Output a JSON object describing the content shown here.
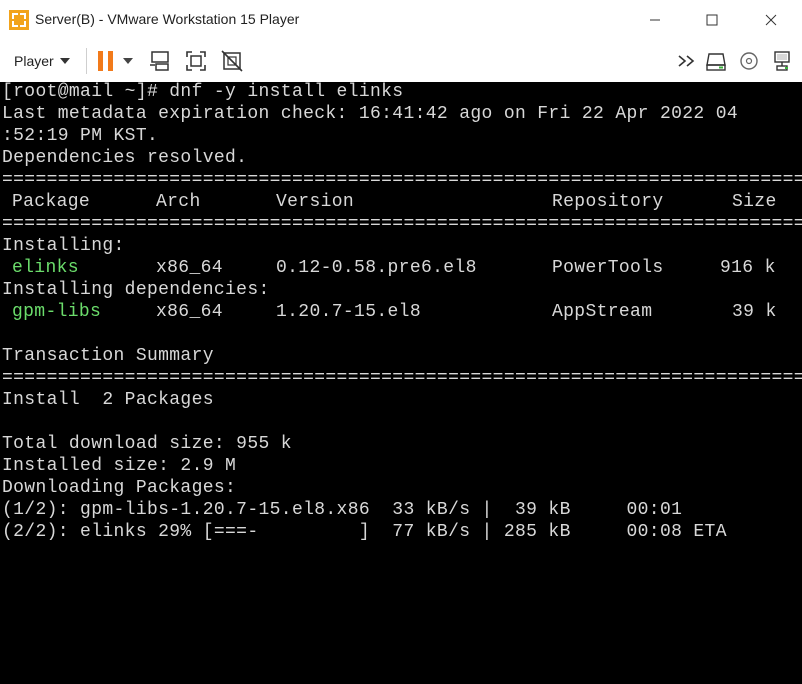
{
  "window": {
    "title": "Server(B) - VMware Workstation 15 Player"
  },
  "toolbar": {
    "player_label": "Player"
  },
  "terminal": {
    "prompt_line": "[root@mail ~]# dnf -y install elinks",
    "metadata_line1": "Last metadata expiration check: 16:41:42 ago on Fri 22 Apr 2022 04",
    "metadata_line2": ":52:19 PM KST.",
    "deps_resolved": "Dependencies resolved.",
    "rule": "==============================================================================================",
    "header": {
      "package": "Package",
      "arch": "Arch",
      "version": "Version",
      "repository": "Repository",
      "size": "Size"
    },
    "installing_label": "Installing:",
    "installing_deps_label": "Installing dependencies:",
    "packages": [
      {
        "name": "elinks",
        "arch": "x86_64",
        "version": "0.12-0.58.pre6.el8",
        "repo": "PowerTools",
        "size": "916 k"
      },
      {
        "name": "gpm-libs",
        "arch": "x86_64",
        "version": "1.20.7-15.el8",
        "repo": "AppStream",
        "size": "39 k"
      }
    ],
    "transaction_summary": "Transaction Summary",
    "install_line": "Install  2 Packages",
    "total_download": "Total download size: 955 k",
    "installed_size": "Installed size: 2.9 M",
    "downloading": "Downloading Packages:",
    "download_lines": [
      "(1/2): gpm-libs-1.20.7-15.el8.x86  33 kB/s |  39 kB     00:01",
      "(2/2): elinks 29% [===-         ]  77 kB/s | 285 kB     00:08 ETA"
    ]
  }
}
